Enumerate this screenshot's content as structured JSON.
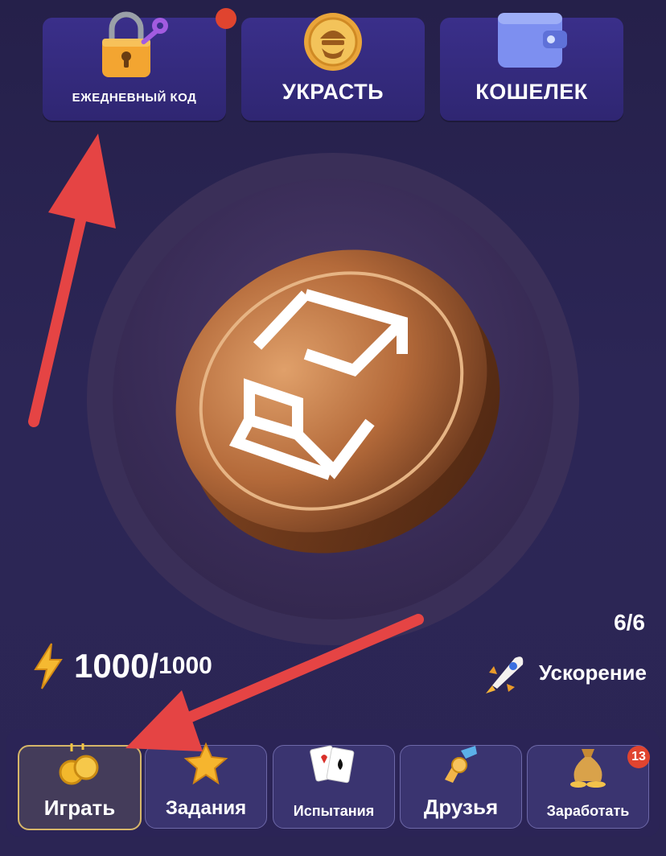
{
  "top_buttons": {
    "daily_code": "ЕЖЕДНЕВНЫЙ КОД",
    "steal": "УКРАСТЬ",
    "wallet": "КОШЕЛЕК"
  },
  "counter": "6/6",
  "energy": {
    "current": "1000/",
    "max": "1000"
  },
  "boost_label": "Ускорение",
  "nav": {
    "items": [
      {
        "label": "Играть",
        "icon": "coins-icon"
      },
      {
        "label": "Задания",
        "icon": "star-icon"
      },
      {
        "label": "Испытания",
        "icon": "cards-icon"
      },
      {
        "label": "Друзья",
        "icon": "handshake-icon"
      },
      {
        "label": "Заработать",
        "icon": "money-bag-icon",
        "badge": "13"
      }
    ]
  },
  "colors": {
    "accent_red": "#e0442f",
    "active_border": "#d6b669",
    "coin": "#b06a3a"
  }
}
